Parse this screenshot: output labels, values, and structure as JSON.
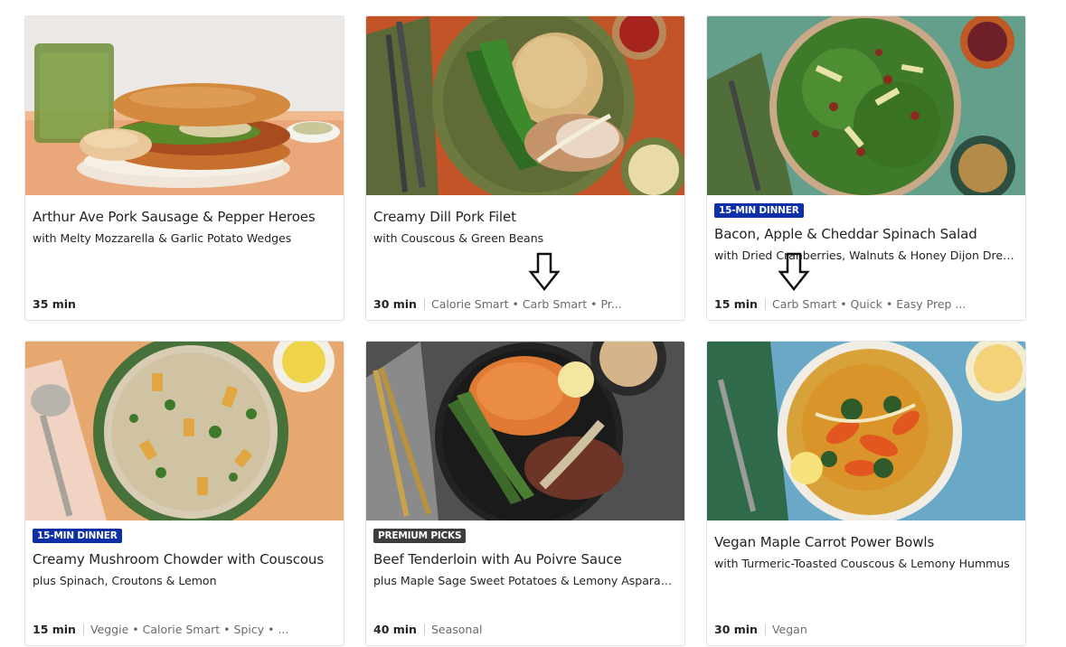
{
  "colors": {
    "badge_15min": "#0d2fa8",
    "badge_premium": "#3d3d3d",
    "tag_text": "#6b6b6b"
  },
  "recipes": [
    {
      "badge": "",
      "title": "Arthur Ave Pork Sausage & Pepper Heroes",
      "subtitle": "with Melty Mozzarella & Garlic Potato Wedges",
      "time": "35 min",
      "tags": ""
    },
    {
      "badge": "",
      "title": "Creamy Dill Pork Filet",
      "subtitle": "with Couscous & Green Beans",
      "time": "30 min",
      "tags": "Calorie Smart • Carb Smart • Pr..."
    },
    {
      "badge": "15-MIN DINNER",
      "title": "Bacon, Apple & Cheddar Spinach Salad",
      "subtitle": "with Dried Cranberries, Walnuts & Honey Dijon Dres...",
      "time": "15 min",
      "tags": "Carb Smart • Quick • Easy Prep ..."
    },
    {
      "badge": "15-MIN DINNER",
      "title": "Creamy Mushroom Chowder with Couscous",
      "subtitle": "plus Spinach, Croutons & Lemon",
      "time": "15 min",
      "tags": "Veggie • Calorie Smart • Spicy • ..."
    },
    {
      "badge": "PREMIUM PICKS",
      "title": "Beef Tenderloin with Au Poivre Sauce",
      "subtitle": "plus Maple Sage Sweet Potatoes & Lemony Asparagus",
      "time": "40 min",
      "tags": "Seasonal"
    },
    {
      "badge": "",
      "title": "Vegan Maple Carrot Power Bowls",
      "subtitle": "with Turmeric-Toasted Couscous & Lemony Hummus",
      "time": "30 min",
      "tags": "Vegan"
    }
  ],
  "annotations": [
    {
      "icon": "down-arrow-icon"
    },
    {
      "icon": "down-arrow-icon"
    }
  ]
}
